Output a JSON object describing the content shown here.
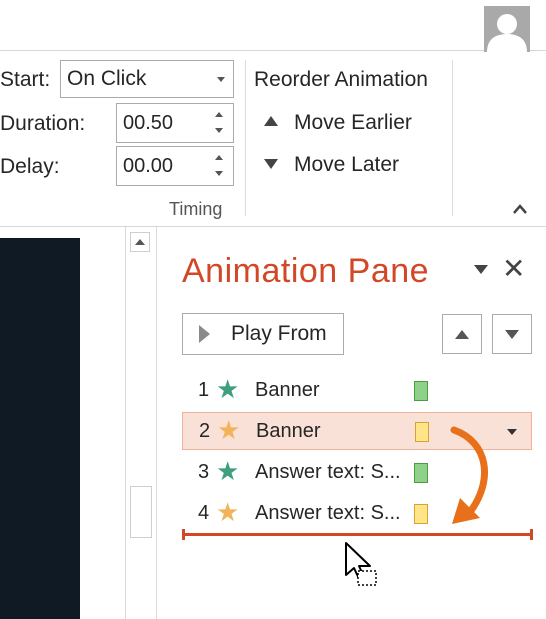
{
  "ribbon": {
    "start_label": "Start:",
    "start_value": "On Click",
    "duration_label": "Duration:",
    "duration_value": "00.50",
    "delay_label": "Delay:",
    "delay_value": "00.00",
    "reorder_title": "Reorder Animation",
    "move_earlier": "Move Earlier",
    "move_later": "Move Later",
    "group_label": "Timing"
  },
  "pane": {
    "title": "Animation Pane",
    "play_from": "Play From",
    "items": [
      {
        "num": "1",
        "label": "Banner",
        "star_color": "#3f9e7e",
        "bar_fill": "#8fd18a",
        "bar_border": "#4a9e3f"
      },
      {
        "num": "2",
        "label": "Banner",
        "star_color": "#f2b35a",
        "bar_fill": "#ffe588",
        "bar_border": "#d9a233"
      },
      {
        "num": "3",
        "label": "Answer text: S...",
        "star_color": "#3f9e7e",
        "bar_fill": "#8fd18a",
        "bar_border": "#4a9e3f"
      },
      {
        "num": "4",
        "label": "Answer text: S...",
        "star_color": "#f2b35a",
        "bar_fill": "#ffe588",
        "bar_border": "#d9a233"
      }
    ]
  },
  "colors": {
    "accent": "#d24726",
    "arrow": "#e8701a",
    "selected_row_bg": "#f9e1d8"
  }
}
